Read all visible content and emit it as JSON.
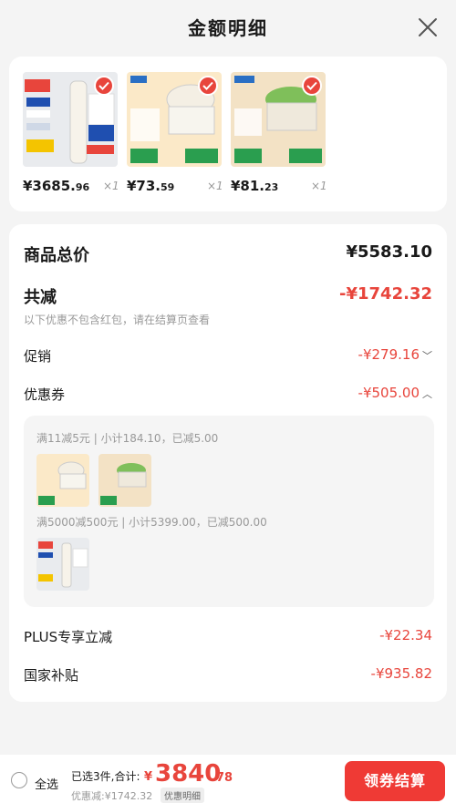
{
  "header": {
    "title": "金额明细"
  },
  "products": [
    {
      "price_int": "¥3685.",
      "price_dec": "96",
      "qty": "×1"
    },
    {
      "price_int": "¥73.",
      "price_dec": "59",
      "qty": "×1"
    },
    {
      "price_int": "¥81.",
      "price_dec": "23",
      "qty": "×1"
    }
  ],
  "summary": {
    "total_label": "商品总价",
    "total_value": "¥5583.10",
    "reduce_label": "共减",
    "reduce_value": "-¥1742.32",
    "note": "以下优惠不包含红包，请在结算页查看",
    "promo_label": "促销",
    "promo_value": "-¥279.16",
    "coupon_label": "优惠券",
    "coupon_value": "-¥505.00",
    "coupon_line1": "满11减5元 | 小计184.10，已减5.00",
    "coupon_line2": "满5000减500元 | 小计5399.00，已减500.00",
    "plus_label": "PLUS专享立减",
    "plus_value": "-¥22.34",
    "subsidy_label": "国家补贴",
    "subsidy_value": "-¥935.82"
  },
  "bottom": {
    "select_all": "全选",
    "selected_text": "已选3件,合计:",
    "yen": "¥",
    "total_int": "3840",
    "total_dec": ".78",
    "discount_text": "优惠减:¥1742.32",
    "detail_tag": "优惠明细",
    "checkout": "领券结算"
  },
  "colors": {
    "accent": "#e8453c",
    "checkout_bg": "#ef3a35"
  }
}
